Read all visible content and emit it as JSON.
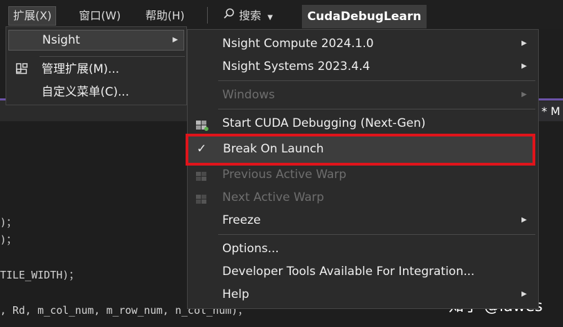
{
  "menubar": {
    "extensions": "扩展(X)",
    "window": "窗口(W)",
    "help": "帮助(H)",
    "search_label": "搜索",
    "solution_name": "CudaDebugLearn"
  },
  "extensions_menu": {
    "items": [
      {
        "label": "Nsight",
        "has_submenu": true
      },
      {
        "label": "管理扩展(M)..."
      },
      {
        "label": "自定义菜单(C)..."
      }
    ]
  },
  "nsight_submenu": {
    "compute": "Nsight Compute 2024.1.0",
    "systems": "Nsight Systems 2023.4.4",
    "windows": "Windows",
    "start_debugging": "Start CUDA Debugging (Next-Gen)",
    "break_on_launch": "Break On Launch",
    "previous_warp": "Previous Active Warp",
    "next_warp": "Next Active Warp",
    "freeze": "Freeze",
    "options": "Options...",
    "dev_tools": "Developer Tools Available For Integration...",
    "help": "Help"
  },
  "editor": {
    "tab_label": "* M",
    "lines": [
      ")；",
      ")；",
      "TILE_WIDTH)；",
      ", Rd, m_col_num, m_row_num, n_col_num)；"
    ]
  },
  "watermark": "知乎 @lawes",
  "colors": {
    "highlight": "#e0141b",
    "accent_tab": "#6b52a8",
    "menu_bg": "#2b2b2b"
  }
}
